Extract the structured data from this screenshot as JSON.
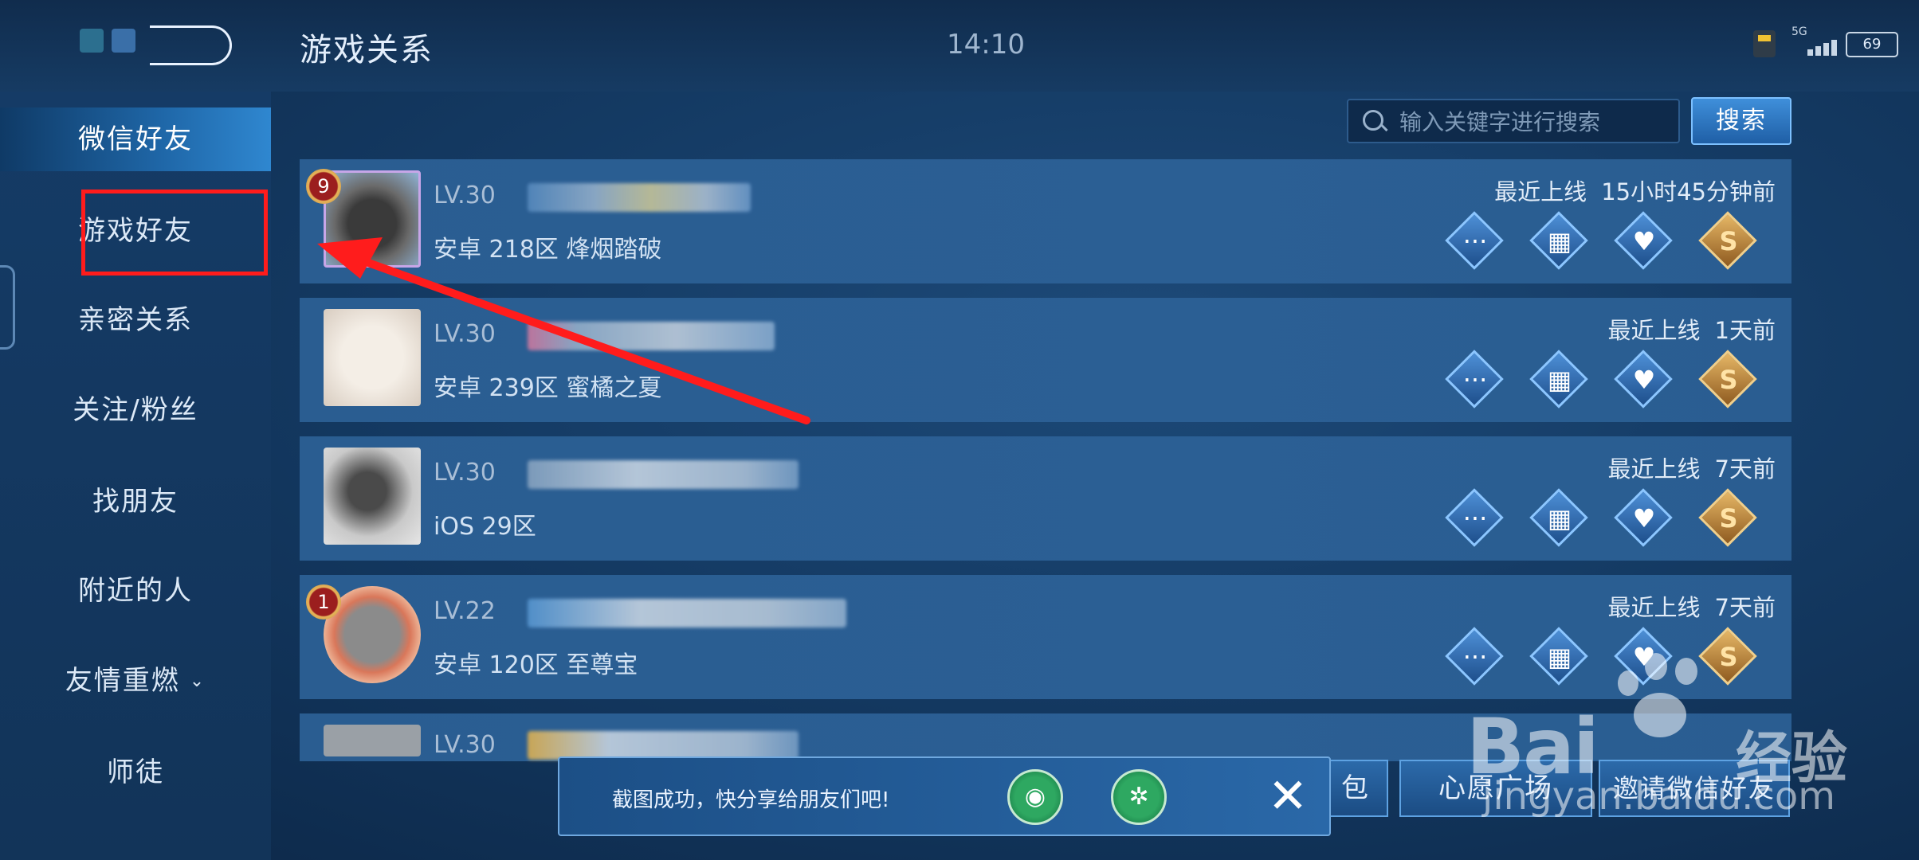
{
  "header": {
    "title": "游戏关系",
    "clock": "14:10",
    "network": "5G",
    "battery": "69"
  },
  "sidebar": {
    "items": [
      {
        "label": "微信好友",
        "active": true
      },
      {
        "label": "游戏好友",
        "highlighted": true
      },
      {
        "label": "亲密关系"
      },
      {
        "label": "关注/粉丝"
      },
      {
        "label": "找朋友"
      },
      {
        "label": "附近的人"
      },
      {
        "label": "友情重燃",
        "chevron": "⌄"
      },
      {
        "label": "师徒"
      }
    ]
  },
  "search": {
    "placeholder": "输入关键字进行搜索",
    "button_label": "搜索"
  },
  "friends": [
    {
      "level": "LV.30",
      "server": "安卓 218区 烽烟踏破",
      "last_online_label": "最近上线",
      "last_online": "15小时45分钟前",
      "rank": "9"
    },
    {
      "level": "LV.30",
      "server": "安卓 239区 蜜橘之夏",
      "last_online_label": "最近上线",
      "last_online": "1天前"
    },
    {
      "level": "LV.30",
      "server": "iOS 29区",
      "last_online_label": "最近上线",
      "last_online": "7天前"
    },
    {
      "level": "LV.22",
      "server": "安卓 120区 至尊宝",
      "last_online_label": "最近上线",
      "last_online": "7天前",
      "rank": "1"
    },
    {
      "level": "LV.30"
    }
  ],
  "row_actions": {
    "chat_icon": "chat-bubble-icon",
    "gift_icon": "gift-icon",
    "heart_icon": "heart-card-icon",
    "coin_icon": "gold-coin-icon"
  },
  "bottom": {
    "btn1": "包",
    "btn2": "心愿广场",
    "btn3": "邀请微信好友"
  },
  "toast": {
    "text": "截图成功，快分享给朋友们吧!",
    "close": "✕"
  },
  "watermark": {
    "brand": "Bai",
    "cn": "经验",
    "url": "jingyan.baidu.com"
  },
  "colors": {
    "annotation_red": "#ff1c1c",
    "accent_blue": "#2f87d0",
    "gold": "#e6b766"
  }
}
